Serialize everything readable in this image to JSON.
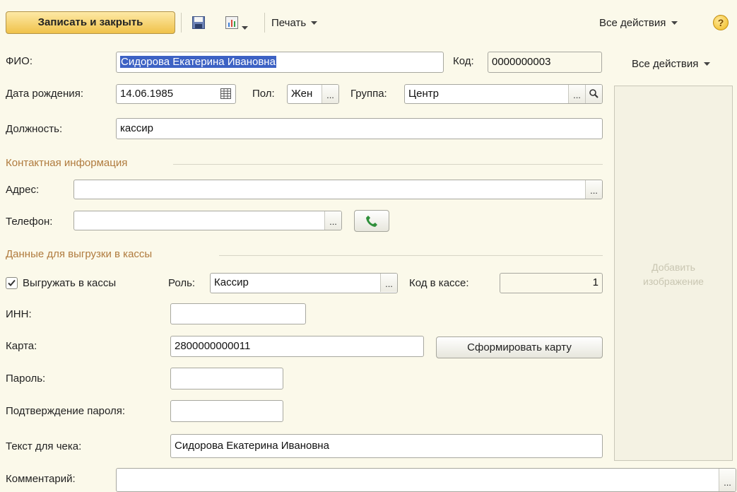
{
  "toolbar": {
    "save_close": "Записать и закрыть",
    "print": "Печать",
    "all_actions": "Все действия",
    "help_symbol": "?"
  },
  "side_panel": {
    "all_actions": "Все действия",
    "add_image": "Добавить изображение"
  },
  "form": {
    "fio_label": "ФИО:",
    "fio_value": "Сидорова Екатерина Ивановна",
    "code_label": "Код:",
    "code_value": "0000000003",
    "birth_label": "Дата рождения:",
    "birth_value": "14.06.1985",
    "sex_label": "Пол:",
    "sex_value": "Жен",
    "group_label": "Группа:",
    "group_value": "Центр",
    "position_label": "Должность:",
    "position_value": "кассир"
  },
  "contact": {
    "section_title": "Контактная информация",
    "address_label": "Адрес:",
    "address_value": "",
    "phone_label": "Телефон:",
    "phone_value": ""
  },
  "cash": {
    "section_title": "Данные для выгрузки в кассы",
    "export_label": "Выгружать в кассы",
    "export_checked": true,
    "role_label": "Роль:",
    "role_value": "Кассир",
    "cash_code_label": "Код в кассе:",
    "cash_code_value": "1",
    "inn_label": "ИНН:",
    "inn_value": "",
    "card_label": "Карта:",
    "card_value": "2800000000011",
    "make_card_button": "Сформировать карту",
    "password_label": "Пароль:",
    "confirm_label": "Подтверждение пароля:",
    "receipt_label": "Текст для чека:",
    "receipt_value": "Сидорова Екатерина Ивановна"
  },
  "comment": {
    "label": "Комментарий:",
    "value": ""
  },
  "colors": {
    "background": "#fbf9ea",
    "section_title": "#b07b3e",
    "primary_button": "#f2c84f",
    "selection": "#3d62c4"
  }
}
